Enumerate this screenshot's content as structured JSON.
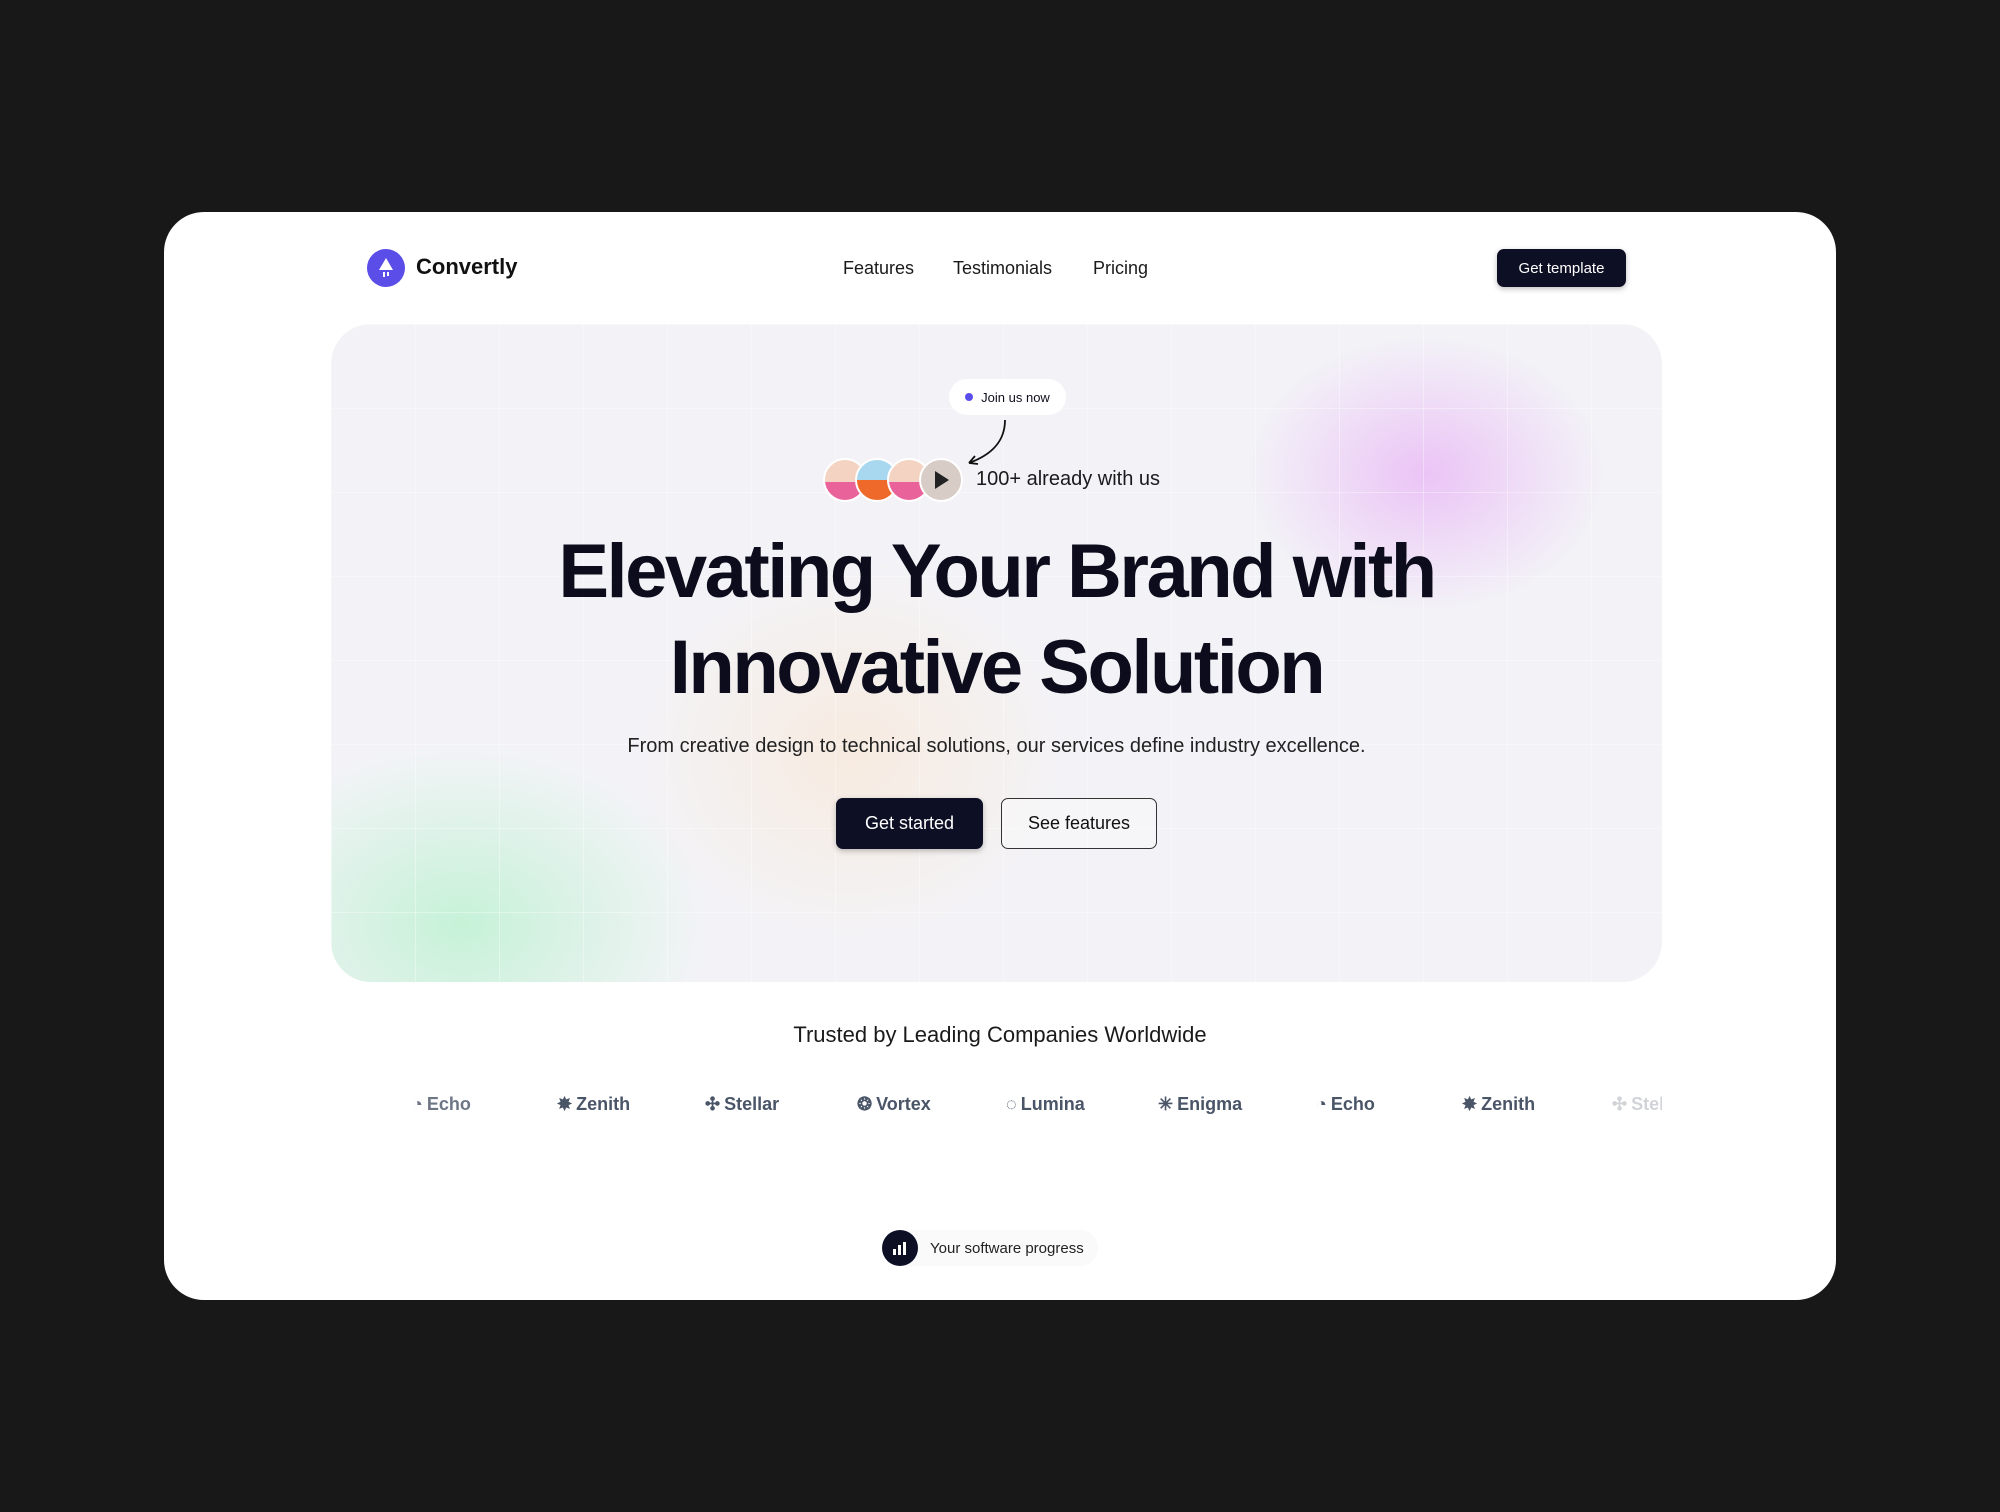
{
  "brand": {
    "name": "Convertly",
    "accent": "#5b4de8"
  },
  "nav": {
    "items": [
      "Features",
      "Testimonials",
      "Pricing"
    ],
    "cta": "Get template"
  },
  "hero": {
    "badge": "Join us now",
    "social_proof": "100+ already with us",
    "title_line1": "Elevating Your Brand with",
    "title_line2": "Innovative Solution",
    "subtitle": "From creative design to technical solutions, our services define industry excellence.",
    "primary_button": "Get started",
    "secondary_button": "See features"
  },
  "trusted": {
    "heading": "Trusted by Leading Companies Worldwide",
    "logos": [
      "Echo",
      "Zenith",
      "Stellar",
      "Vortex",
      "Lumina",
      "Enigma",
      "Echo",
      "Zenith",
      "Stellar"
    ]
  },
  "bottom_badge": {
    "label": "Your software progress",
    "icon": "bar-chart-icon"
  }
}
